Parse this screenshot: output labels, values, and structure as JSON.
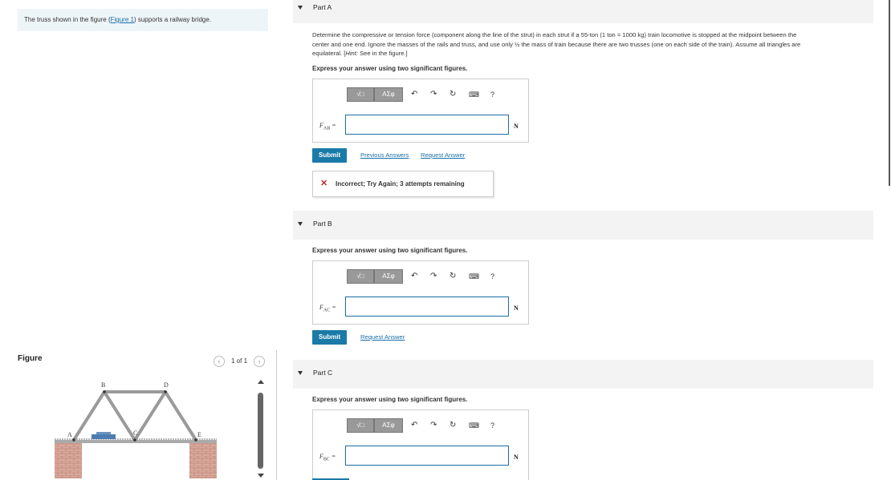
{
  "intro": {
    "text_before": "The truss shown in the figure (",
    "link": "Figure 1",
    "text_after": ") supports a railway bridge."
  },
  "figure": {
    "title": "Figure",
    "pager": "1 of 1",
    "labels": {
      "A": "A",
      "B": "B",
      "C": "C",
      "D": "D",
      "E": "E"
    }
  },
  "toolbar": {
    "templates": "√□",
    "greek": "AΣφ",
    "help": "?"
  },
  "parts": [
    {
      "label": "Part A",
      "question": {
        "l1": "Determine the compressive or tension force (component along the line of the strut) in each strut if a 55-ton (1 ton = 1000 kg) train locomotive is stopped at the midpoint between the",
        "l2": "center and one end. Ignore the masses of the rails and truss, and use only ½ the mass of train because there are two trusses (one on each side of the train). Assume all triangles are",
        "l3_prefix": "equilateral. [",
        "hint_label": "Hint:",
        "l3_suffix": " See in the figure.]"
      },
      "express": "Express your answer using two significant figures.",
      "variable": "F",
      "subscript": "AB",
      "unit": "N",
      "submit": "Submit",
      "links": [
        "Previous Answers",
        "Request Answer"
      ],
      "feedback": "Incorrect; Try Again; 3 attempts remaining"
    },
    {
      "label": "Part B",
      "express": "Express your answer using two significant figures.",
      "variable": "F",
      "subscript": "AC",
      "unit": "N",
      "submit": "Submit",
      "links": [
        "Request Answer"
      ]
    },
    {
      "label": "Part C",
      "express": "Express your answer using two significant figures.",
      "variable": "F",
      "subscript": "BC",
      "unit": "N"
    }
  ]
}
